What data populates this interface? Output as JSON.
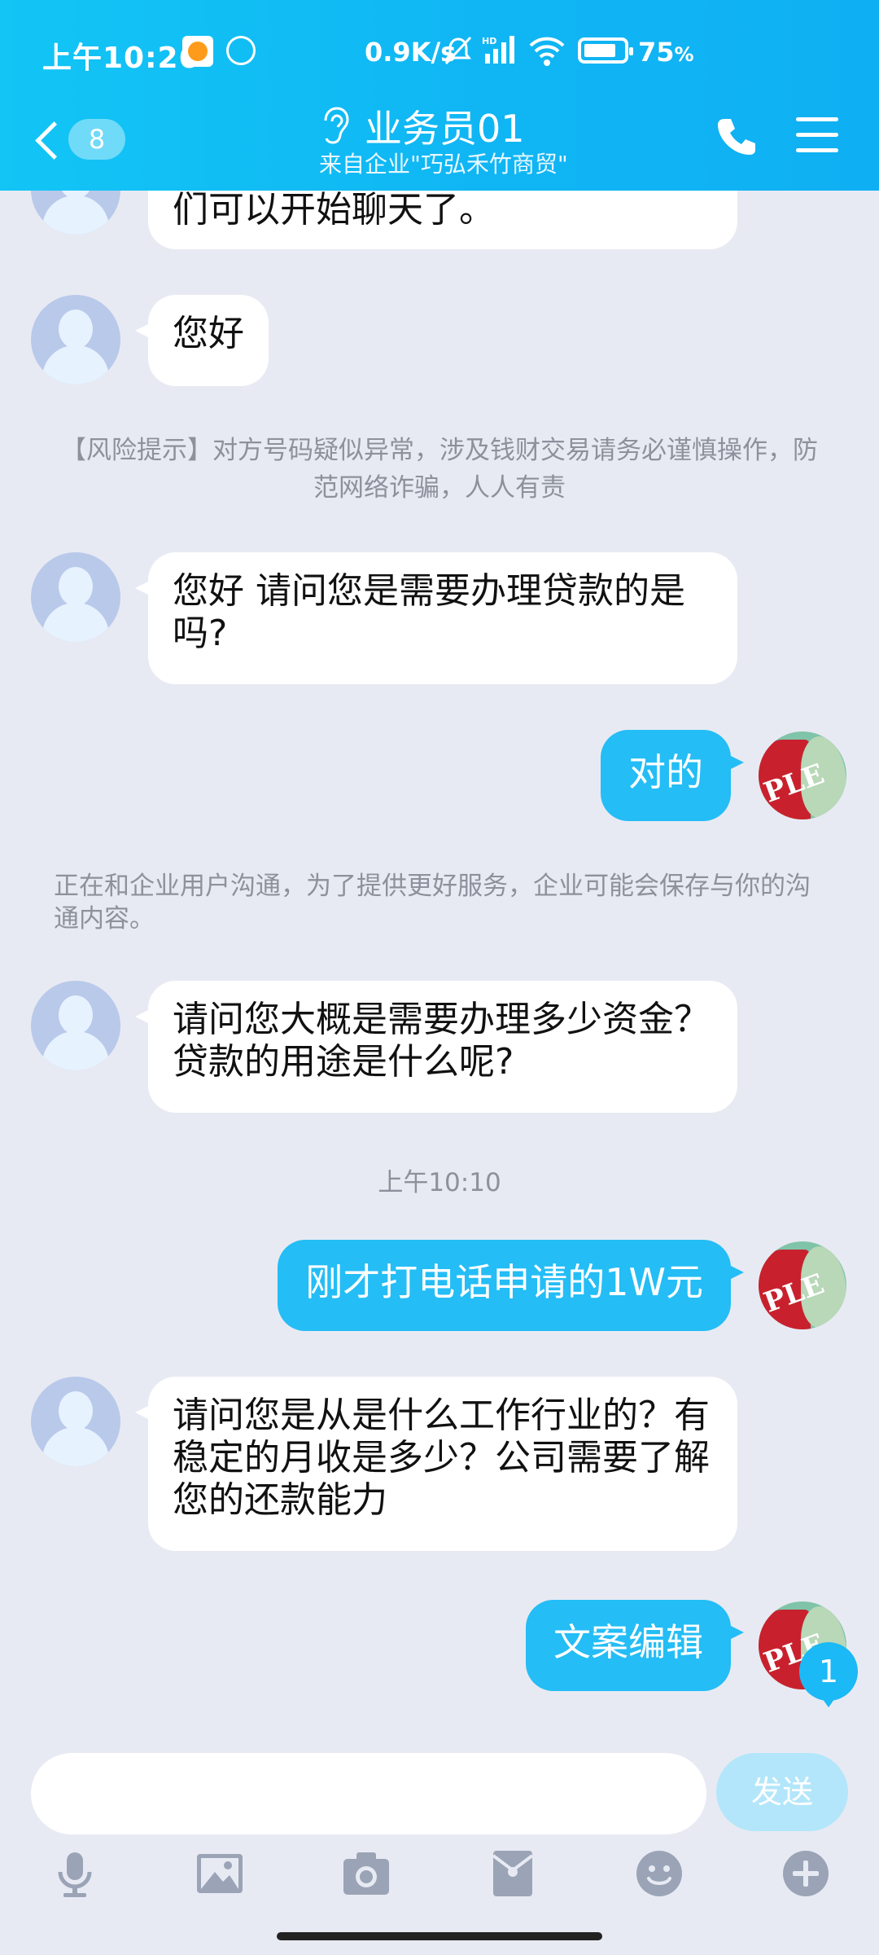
{
  "status_bar": {
    "time": "上午10:26",
    "network_speed": "0.9K/s",
    "battery": "75",
    "battery_unit": "%"
  },
  "nav": {
    "back_count": "8",
    "title": "业务员01",
    "subtitle": "来自企业\"巧弘禾竹商贸\""
  },
  "messages": [
    {
      "side": "left",
      "text": "们可以开始聊天了。"
    },
    {
      "side": "left",
      "text": "您好"
    },
    {
      "side": "system",
      "text": "【风险提示】对方号码疑似异常，涉及钱财交易请务必谨慎操作，防范网络诈骗，人人有责"
    },
    {
      "side": "left",
      "text": "您好 请问您是需要办理贷款的是吗?"
    },
    {
      "side": "right",
      "text": "对的"
    },
    {
      "side": "system",
      "text": "正在和企业用户沟通，为了提供更好服务，企业可能会保存与你的沟通内容。"
    },
    {
      "side": "left",
      "text": "请问您大概是需要办理多少资金？贷款的用途是什么呢?"
    },
    {
      "side": "timestamp",
      "text": "上午10:10"
    },
    {
      "side": "right",
      "text": "刚才打电话申请的1W元"
    },
    {
      "side": "left",
      "text": "请问您是从是什么工作行业的？有稳定的月收是多少？公司需要了解您的还款能力"
    },
    {
      "side": "right",
      "text": "文案编辑"
    }
  ],
  "unread_badge": "1",
  "input": {
    "value": "",
    "send_label": "发送"
  },
  "toolbar": [
    "microphone-icon",
    "image-icon",
    "camera-icon",
    "red-packet-icon",
    "emoji-icon",
    "plus-icon"
  ],
  "colors": {
    "header": "#12c5f5",
    "bubble_self": "#24bdf6",
    "background": "#e8eaf3",
    "send_disabled": "#b3e6fa"
  }
}
